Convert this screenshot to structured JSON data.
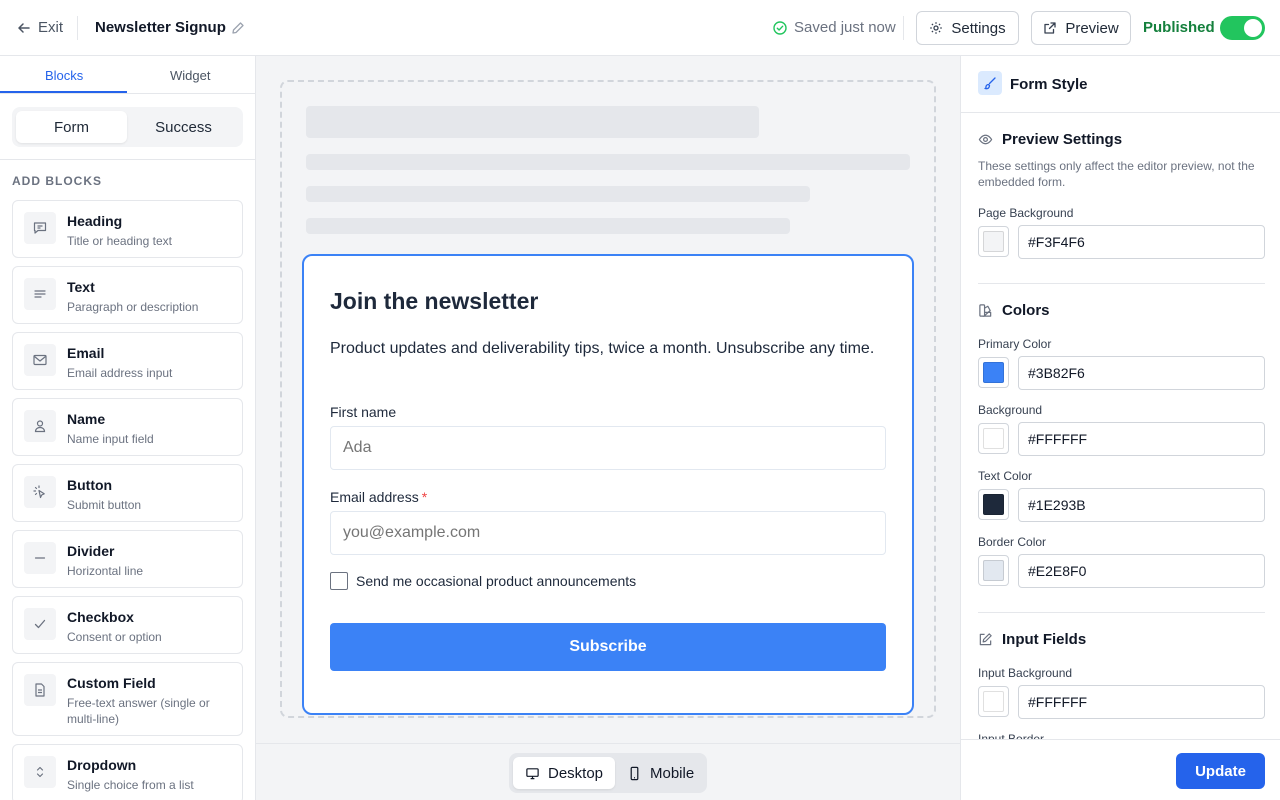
{
  "header": {
    "exit_label": "Exit",
    "title": "Newsletter Signup",
    "save_status": "Saved just now",
    "settings_label": "Settings",
    "preview_label": "Preview",
    "published_label": "Published",
    "published_on": true
  },
  "sidebar": {
    "tabs": [
      {
        "label": "Blocks",
        "active": true
      },
      {
        "label": "Widget",
        "active": false
      }
    ],
    "segments": [
      {
        "label": "Form",
        "active": true
      },
      {
        "label": "Success",
        "active": false
      }
    ],
    "section_label": "ADD BLOCKS",
    "blocks": [
      {
        "name": "Heading",
        "desc": "Title or heading text",
        "icon": "message-square-icon"
      },
      {
        "name": "Text",
        "desc": "Paragraph or description",
        "icon": "align-left-icon"
      },
      {
        "name": "Email",
        "desc": "Email address input",
        "icon": "mail-icon"
      },
      {
        "name": "Name",
        "desc": "Name input field",
        "icon": "user-icon"
      },
      {
        "name": "Button",
        "desc": "Submit button",
        "icon": "pointer-click-icon"
      },
      {
        "name": "Divider",
        "desc": "Horizontal line",
        "icon": "minus-icon"
      },
      {
        "name": "Checkbox",
        "desc": "Consent or option",
        "icon": "check-icon"
      },
      {
        "name": "Custom Field",
        "desc": "Free-text answer (single or multi-line)",
        "icon": "file-text-icon"
      },
      {
        "name": "Dropdown",
        "desc": "Single choice from a list",
        "icon": "chevrons-up-down-icon"
      }
    ]
  },
  "form": {
    "heading": "Join the newsletter",
    "description": "Product updates and deliverability tips, twice a month. Unsubscribe any time.",
    "first_name_label": "First name",
    "first_name_placeholder": "Ada",
    "email_label": "Email address",
    "email_required_mark": "*",
    "email_placeholder": "you@example.com",
    "checkbox_label": "Send me occasional product announcements",
    "checkbox_checked": false,
    "submit_label": "Subscribe"
  },
  "device_toggle": [
    {
      "label": "Desktop",
      "icon": "monitor-icon",
      "active": true
    },
    {
      "label": "Mobile",
      "icon": "smartphone-icon",
      "active": false
    }
  ],
  "style_panel": {
    "title": "Form Style",
    "preview_settings": {
      "heading": "Preview Settings",
      "note": "These settings only affect the editor preview, not the embedded form.",
      "page_background_label": "Page Background",
      "page_background": "#F3F4F6"
    },
    "colors": {
      "heading": "Colors",
      "primary_label": "Primary Color",
      "primary": "#3B82F6",
      "background_label": "Background",
      "background": "#FFFFFF",
      "text_label": "Text Color",
      "text": "#1E293B",
      "border_label": "Border Color",
      "border": "#E2E8F0"
    },
    "input_fields": {
      "heading": "Input Fields",
      "input_background_label": "Input Background",
      "input_background": "#FFFFFF",
      "input_border_label": "Input Border"
    },
    "update_label": "Update"
  }
}
